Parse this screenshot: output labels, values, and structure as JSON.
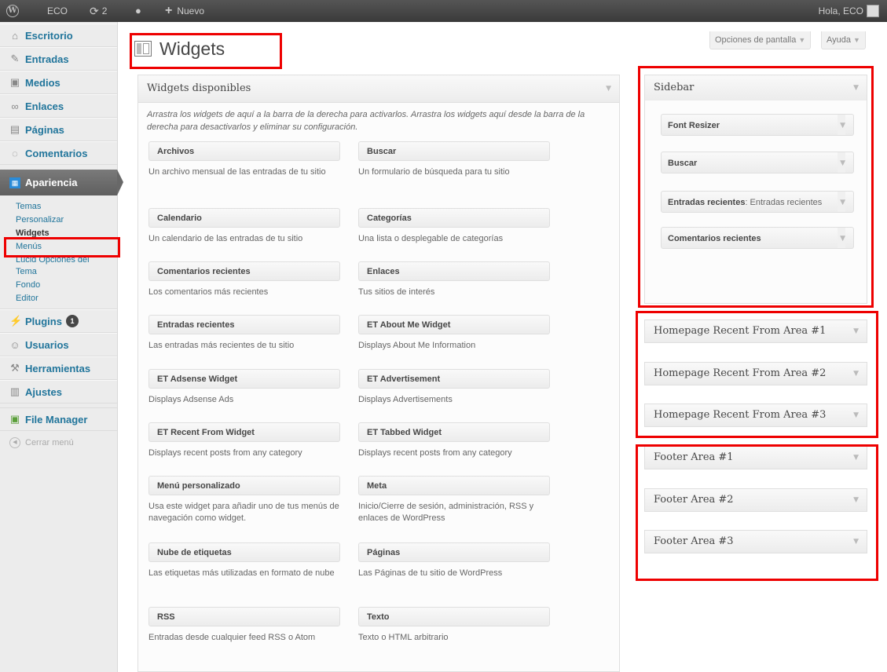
{
  "adminbar": {
    "wp_logo": "W",
    "site_name": "ECO",
    "updates_count": "2",
    "new_label": "Nuevo",
    "howdy": "Hola, ECO"
  },
  "menu": {
    "items": [
      {
        "label": "Escritorio",
        "icon": "home-icon"
      },
      {
        "label": "Entradas",
        "icon": "pin-icon"
      },
      {
        "label": "Medios",
        "icon": "media-icon"
      },
      {
        "label": "Enlaces",
        "icon": "link-icon"
      },
      {
        "label": "Páginas",
        "icon": "page-icon"
      },
      {
        "label": "Comentarios",
        "icon": "comment-icon"
      },
      {
        "label": "Apariencia",
        "icon": "appearance-icon"
      },
      {
        "label": "Plugins",
        "icon": "plugin-icon",
        "badge": "1"
      },
      {
        "label": "Usuarios",
        "icon": "users-icon"
      },
      {
        "label": "Herramientas",
        "icon": "tools-icon"
      },
      {
        "label": "Ajustes",
        "icon": "settings-icon"
      },
      {
        "label": "File Manager",
        "icon": "file-manager-icon"
      }
    ],
    "submenu": [
      "Temas",
      "Personalizar",
      "Widgets",
      "Menús",
      "Lucid Opciones del Tema",
      "Fondo",
      "Editor"
    ],
    "collapse": "Cerrar menú"
  },
  "page": {
    "title": "Widgets",
    "screen_options": "Opciones de pantalla",
    "help": "Ayuda"
  },
  "available": {
    "title": "Widgets disponibles",
    "description": "Arrastra los widgets de aquí a la barra de la derecha para activarlos. Arrastra los widgets aquí desde la barra de la derecha para desactivarlos y eliminar su configuración.",
    "widgets": [
      {
        "title": "Archivos",
        "desc": "Un archivo mensual de las entradas de tu sitio"
      },
      {
        "title": "Buscar",
        "desc": "Un formulario de búsqueda para tu sitio"
      },
      {
        "title": "Calendario",
        "desc": "Un calendario de las entradas de tu sitio"
      },
      {
        "title": "Categorías",
        "desc": "Una lista o desplegable de categorías"
      },
      {
        "title": "Comentarios recientes",
        "desc": "Los comentarios más recientes"
      },
      {
        "title": "Enlaces",
        "desc": "Tus sitios de interés"
      },
      {
        "title": "Entradas recientes",
        "desc": "Las entradas más recientes de tu sitio"
      },
      {
        "title": "ET About Me Widget",
        "desc": "Displays About Me Information"
      },
      {
        "title": "ET Adsense Widget",
        "desc": "Displays Adsense Ads"
      },
      {
        "title": "ET Advertisement",
        "desc": "Displays Advertisements"
      },
      {
        "title": "ET Recent From Widget",
        "desc": "Displays recent posts from any category"
      },
      {
        "title": "ET Tabbed Widget",
        "desc": "Displays recent posts from any category"
      },
      {
        "title": "Menú personalizado",
        "desc": "Usa este widget para añadir uno de tus menús de navegación como widget."
      },
      {
        "title": "Meta",
        "desc": "Inicio/Cierre de sesión, administración, RSS y enlaces de WordPress"
      },
      {
        "title": "Nube de etiquetas",
        "desc": "Las etiquetas más utilizadas en formato de nube"
      },
      {
        "title": "Páginas",
        "desc": "Las Páginas de tu sitio de WordPress"
      },
      {
        "title": "RSS",
        "desc": "Entradas desde cualquier feed RSS o Atom"
      },
      {
        "title": "Texto",
        "desc": "Texto o HTML arbitrario"
      }
    ]
  },
  "sidebars": {
    "sidebar": {
      "title": "Sidebar",
      "widgets": [
        {
          "title": "Font Resizer",
          "instance": ""
        },
        {
          "title": "Buscar",
          "instance": ""
        },
        {
          "title": "Entradas recientes",
          "instance": ": Entradas recientes"
        },
        {
          "title": "Comentarios recientes",
          "instance": ""
        }
      ]
    },
    "homepage": [
      "Homepage Recent From Area #1",
      "Homepage Recent From Area #2",
      "Homepage Recent From Area #3"
    ],
    "footer": [
      "Footer Area #1",
      "Footer Area #2",
      "Footer Area #3"
    ]
  }
}
